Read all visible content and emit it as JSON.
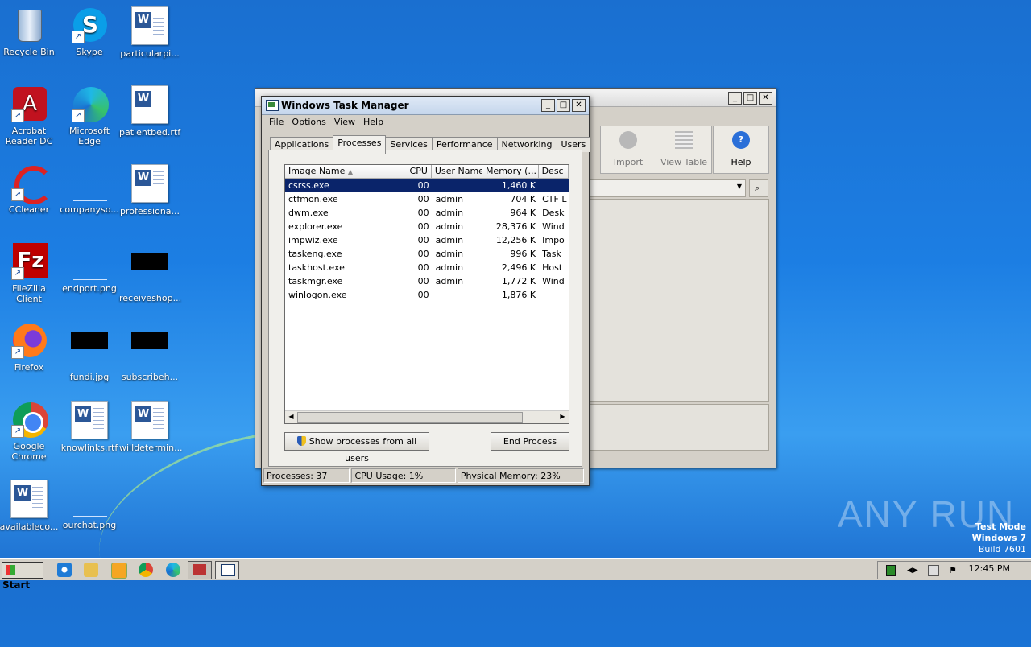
{
  "desktop": {
    "icons": [
      {
        "label": "Recycle Bin",
        "icon": "recycle-bin-icon"
      },
      {
        "label": "Skype",
        "icon": "skype-icon"
      },
      {
        "label": "particularpi...",
        "icon": "word-doc-icon"
      },
      {
        "label": "Acrobat Reader DC",
        "icon": "acrobat-icon"
      },
      {
        "label": "Microsoft Edge",
        "icon": "edge-icon"
      },
      {
        "label": "patientbed.rtf",
        "icon": "word-doc-icon"
      },
      {
        "label": "CCleaner",
        "icon": "ccleaner-icon"
      },
      {
        "label": "companyso...",
        "icon": "blank-file-icon"
      },
      {
        "label": "professiona...",
        "icon": "word-doc-icon"
      },
      {
        "label": "FileZilla Client",
        "icon": "filezilla-icon"
      },
      {
        "label": "endport.png",
        "icon": "blank-file-icon"
      },
      {
        "label": "receiveshop...",
        "icon": "black-image-icon"
      },
      {
        "label": "Firefox",
        "icon": "firefox-icon"
      },
      {
        "label": "fundi.jpg",
        "icon": "black-image-icon"
      },
      {
        "label": "subscribeh...",
        "icon": "black-image-icon"
      },
      {
        "label": "Google Chrome",
        "icon": "chrome-icon"
      },
      {
        "label": "knowlinks.rtf",
        "icon": "word-doc-icon"
      },
      {
        "label": "willdetermin...",
        "icon": "word-doc-icon"
      },
      {
        "label": "availableco...",
        "icon": "word-doc-icon"
      },
      {
        "label": "ourchat.png",
        "icon": "blank-file-icon"
      }
    ]
  },
  "bg_window": {
    "buttons": {
      "import": "Import",
      "view_table": "View Table",
      "help": "Help"
    }
  },
  "taskmgr": {
    "title": "Windows Task Manager",
    "menu": [
      "File",
      "Options",
      "View",
      "Help"
    ],
    "tabs": [
      "Applications",
      "Processes",
      "Services",
      "Performance",
      "Networking",
      "Users"
    ],
    "active_tab": "Processes",
    "columns": [
      "Image Name",
      "CPU",
      "User Name",
      "Memory (...",
      "Desc"
    ],
    "rows": [
      {
        "name": "csrss.exe",
        "cpu": "00",
        "user": "",
        "mem": "1,460 K",
        "desc": ""
      },
      {
        "name": "ctfmon.exe",
        "cpu": "00",
        "user": "admin",
        "mem": "704 K",
        "desc": "CTF L"
      },
      {
        "name": "dwm.exe",
        "cpu": "00",
        "user": "admin",
        "mem": "964 K",
        "desc": "Desk"
      },
      {
        "name": "explorer.exe",
        "cpu": "00",
        "user": "admin",
        "mem": "28,376 K",
        "desc": "Wind"
      },
      {
        "name": "impwiz.exe",
        "cpu": "00",
        "user": "admin",
        "mem": "12,256 K",
        "desc": "Impo"
      },
      {
        "name": "taskeng.exe",
        "cpu": "00",
        "user": "admin",
        "mem": "996 K",
        "desc": "Task"
      },
      {
        "name": "taskhost.exe",
        "cpu": "00",
        "user": "admin",
        "mem": "2,496 K",
        "desc": "Host"
      },
      {
        "name": "taskmgr.exe",
        "cpu": "00",
        "user": "admin",
        "mem": "1,772 K",
        "desc": "Wind"
      },
      {
        "name": "winlogon.exe",
        "cpu": "00",
        "user": "",
        "mem": "1,876 K",
        "desc": ""
      }
    ],
    "show_all_label": "Show processes from all users",
    "end_process_label": "End Process",
    "status": {
      "processes": "Processes: 37",
      "cpu": "CPU Usage: 1%",
      "memory": "Physical Memory: 23%"
    }
  },
  "watermark": {
    "brand": "ANY RUN",
    "line1": "Test Mode",
    "line2": "Windows 7",
    "line3": "Build 7601"
  },
  "taskbar": {
    "start_label": "Start",
    "clock": "12:45 PM"
  }
}
